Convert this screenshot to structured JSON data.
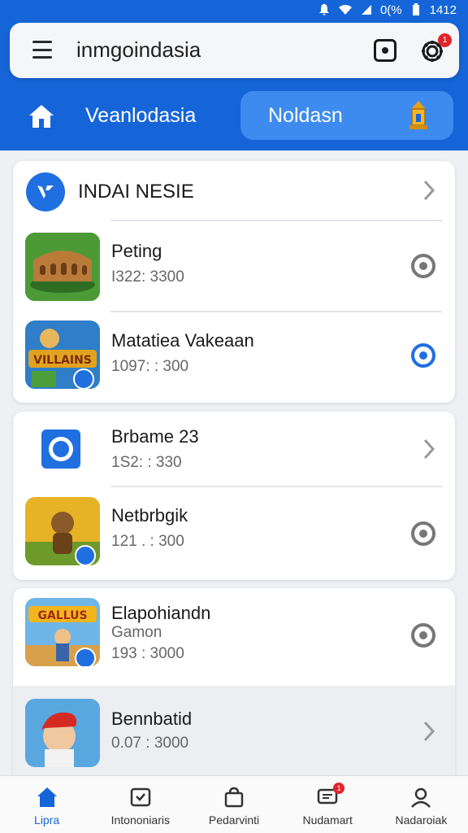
{
  "status_bar": {
    "battery": "0(%",
    "time": "1412"
  },
  "header": {
    "search_text": "inmgoindasia",
    "notification_count": "1",
    "tabs": [
      {
        "label": "Veanlodasia"
      },
      {
        "label": "Noldasn"
      }
    ]
  },
  "cards": {
    "card1": {
      "header_title": "INDAI NESIE",
      "items": [
        {
          "title": "Peting",
          "subtitle": "I322: 3300",
          "state": "off"
        },
        {
          "title": "Matatiea Vakeaan",
          "subtitle": "1097: : 300",
          "state": "on"
        }
      ]
    },
    "card2": {
      "items": [
        {
          "title": "Brbame 23",
          "subtitle": "1S2: : 330",
          "action": "chevron"
        },
        {
          "title": "Netbrbgik",
          "subtitle": "121 . : 300",
          "state": "off"
        }
      ]
    },
    "card3": {
      "items": [
        {
          "title": "Elapohiandn",
          "subtitle": "Gamon",
          "subtitle2": "193 : 3000",
          "state": "off"
        },
        {
          "title": "Bennbatid",
          "subtitle": "0.07 : 3000",
          "action": "chevron"
        }
      ]
    }
  },
  "bottom_nav": {
    "items": [
      {
        "label": "Lipra"
      },
      {
        "label": "Intononiaris"
      },
      {
        "label": "Pedarvinti"
      },
      {
        "label": "Nudamart"
      },
      {
        "label": "Nadaroiak"
      }
    ],
    "badge": "1"
  },
  "colors": {
    "primary": "#1565d8",
    "accent_tab": "#3d8bef",
    "badge": "#e0242c"
  }
}
